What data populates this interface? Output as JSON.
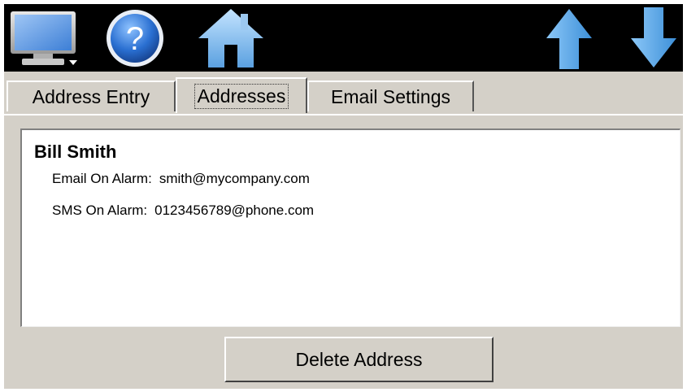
{
  "toolbar": {
    "buttons": [
      {
        "icon": "monitor-icon"
      },
      {
        "icon": "help-icon",
        "glyph": "?"
      },
      {
        "icon": "home-icon"
      },
      {
        "icon": "arrow-up-icon"
      },
      {
        "icon": "arrow-down-icon"
      }
    ]
  },
  "tabs": [
    {
      "label": "Address Entry",
      "active": false
    },
    {
      "label": "Addresses",
      "active": true
    },
    {
      "label": "Email Settings",
      "active": false
    }
  ],
  "contact": {
    "name": "Bill Smith",
    "email_label": "Email On Alarm:",
    "email_value": "smith@mycompany.com",
    "sms_label": "SMS On Alarm:",
    "sms_value": "0123456789@phone.com"
  },
  "actions": {
    "delete_label": "Delete Address"
  },
  "colors": {
    "toolbar_bg": "#000000",
    "chrome_bg": "#d4d0c8",
    "arrow_blue": "#5aaee8",
    "help_blue": "#2a6fd1"
  }
}
